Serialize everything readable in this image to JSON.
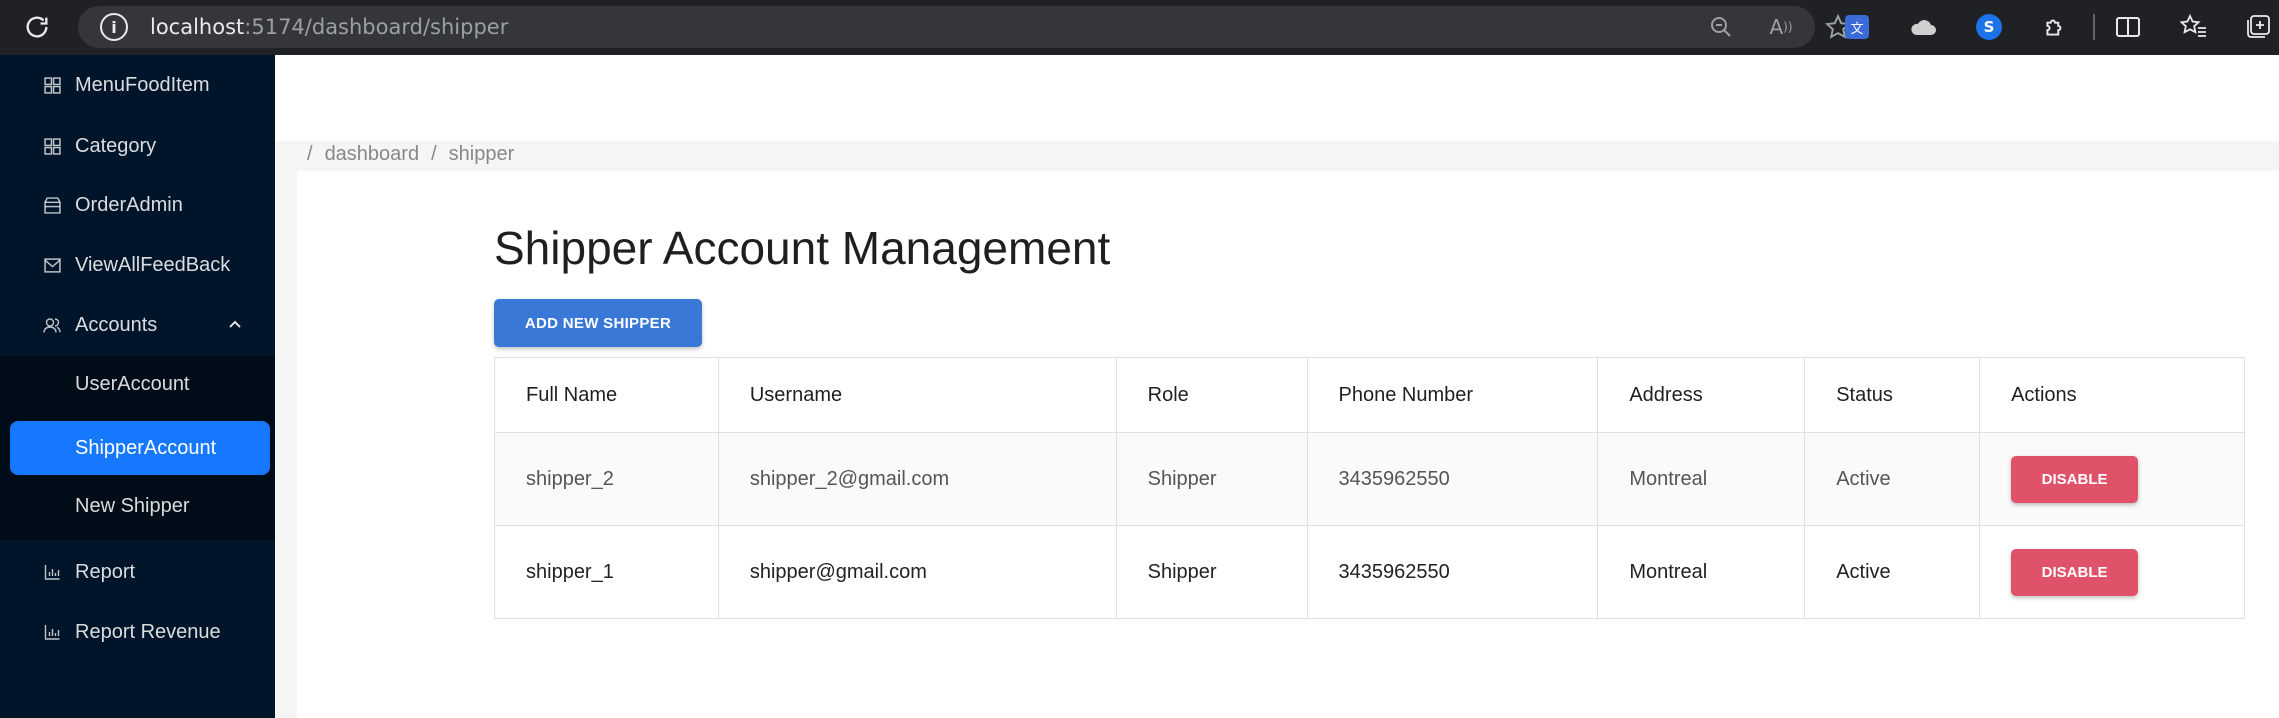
{
  "browser": {
    "url_host": "localhost",
    "url_rest": ":5174/dashboard/shipper",
    "icons": [
      "reload-icon",
      "info-icon",
      "zoom-out-icon",
      "read-aloud-icon",
      "favorite-star-icon",
      "translate-extension-icon",
      "cloud-extension-icon",
      "shazam-extension-icon",
      "extensions-puzzle-icon",
      "split-screen-icon",
      "favorites-icon",
      "collections-icon"
    ]
  },
  "sidebar": {
    "items": [
      {
        "label": "MenuFoodItem",
        "icon": "menu-grid-icon"
      },
      {
        "label": "Category",
        "icon": "category-grid-icon"
      },
      {
        "label": "OrderAdmin",
        "icon": "shop-icon"
      },
      {
        "label": "ViewAllFeedBack",
        "icon": "mail-icon"
      },
      {
        "label": "Accounts",
        "icon": "users-icon",
        "expanded": true
      }
    ],
    "submenu": [
      {
        "label": "UserAccount"
      },
      {
        "label": "ShipperAccount",
        "active": true
      },
      {
        "label": "New Shipper"
      }
    ],
    "bottom_items": [
      {
        "label": "Report",
        "icon": "bar-chart-icon"
      },
      {
        "label": "Report Revenue",
        "icon": "bar-chart-icon"
      }
    ],
    "colors": {
      "background": "#001529",
      "active": "#1677ff"
    }
  },
  "breadcrumb": {
    "items": [
      "dashboard",
      "shipper"
    ],
    "separator": "/"
  },
  "page": {
    "title": "Shipper Account Management",
    "add_button": "ADD NEW SHIPPER"
  },
  "table": {
    "columns": [
      "Full Name",
      "Username",
      "Role",
      "Phone Number",
      "Address",
      "Status",
      "Actions"
    ],
    "rows": [
      {
        "full_name": "shipper_2",
        "username": "shipper_2@gmail.com",
        "role": "Shipper",
        "phone": "3435962550",
        "address": "Montreal",
        "status": "Active",
        "action": "DISABLE"
      },
      {
        "full_name": "shipper_1",
        "username": "shipper@gmail.com",
        "role": "Shipper",
        "phone": "3435962550",
        "address": "Montreal",
        "status": "Active",
        "action": "DISABLE"
      }
    ]
  },
  "colors": {
    "primary_button": "#3a78d8",
    "disable_button": "#e0526a"
  }
}
